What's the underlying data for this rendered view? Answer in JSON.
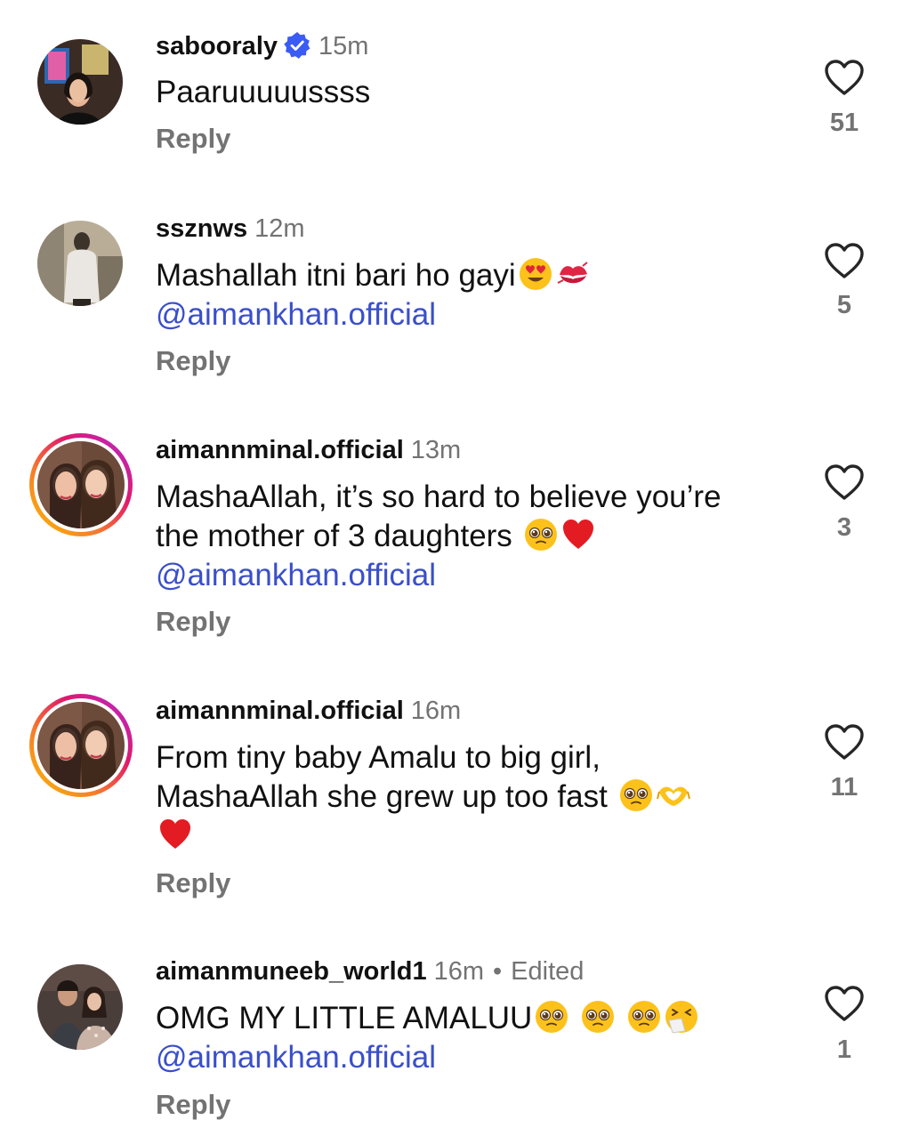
{
  "reply_label": "Reply",
  "mention_handle": "@aimankhan.official",
  "colors": {
    "mention": "#3a4fc9",
    "verified": "#3b5bf5",
    "muted": "#737373"
  },
  "comments": [
    {
      "username": "sabooraly",
      "verified": true,
      "time": "15m",
      "text_lines": [
        "Paaruuuuussss"
      ],
      "likes": "51"
    },
    {
      "username": "ssznws",
      "verified": false,
      "time": "12m",
      "text_lines": [
        "Mashallah itni bari ho gayi"
      ],
      "emojis": [
        "smiling-face-with-heart-eyes",
        "kiss-mark"
      ],
      "likes": "5"
    },
    {
      "username": "aimannminal.official",
      "verified": false,
      "time": "13m",
      "text_lines": [
        "MashaAllah, it’s so hard to believe you’re",
        "the mother of 3 daughters"
      ],
      "emojis": [
        "pleading-face",
        "red-heart"
      ],
      "likes": "3"
    },
    {
      "username": "aimannminal.official",
      "verified": false,
      "time": "16m",
      "text_lines": [
        "From tiny baby Amalu to big girl,",
        "MashaAllah she grew up too fast"
      ],
      "emojis": [
        "pleading-face",
        "heart-hands",
        "red-heart"
      ],
      "likes": "11"
    },
    {
      "username": "aimanmuneeb_world1",
      "verified": false,
      "time": "16m",
      "separator": "•",
      "edited": "Edited",
      "text_lines": [
        "OMG MY LITTLE AMALUU"
      ],
      "emojis": [
        "pleading-face",
        "pleading-face",
        "pleading-face",
        "sneezing-face"
      ],
      "likes": "1"
    }
  ]
}
